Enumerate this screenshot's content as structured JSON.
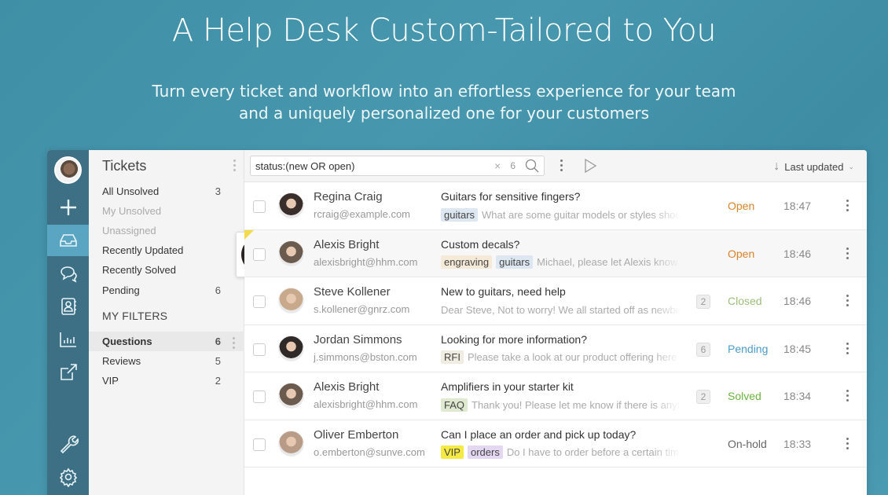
{
  "hero": {
    "title": "A Help Desk Custom-Tailored to You",
    "subtitle_line1": "Turn every ticket and workflow into an effortless experience for your team",
    "subtitle_line2": "and a uniquely personalized one for your customers"
  },
  "rail": {
    "items": [
      {
        "icon": "add-icon",
        "label": "New"
      },
      {
        "icon": "inbox-icon",
        "label": "Tickets",
        "active": true
      },
      {
        "icon": "chat-icon",
        "label": "Conversations"
      },
      {
        "icon": "contacts-icon",
        "label": "Contacts"
      },
      {
        "icon": "reports-icon",
        "label": "Reports"
      },
      {
        "icon": "external-link-icon",
        "label": "Open"
      },
      {
        "icon": "wrench-icon",
        "label": "Tools"
      },
      {
        "icon": "gear-icon",
        "label": "Settings"
      }
    ]
  },
  "filters": {
    "title": "Tickets",
    "views": [
      {
        "label": "All Unsolved",
        "count": "3",
        "muted": false
      },
      {
        "label": "My Unsolved",
        "count": "",
        "muted": true
      },
      {
        "label": "Unassigned",
        "count": "",
        "muted": true
      },
      {
        "label": "Recently Updated",
        "count": "",
        "muted": false
      },
      {
        "label": "Recently Solved",
        "count": "",
        "muted": false
      },
      {
        "label": "Pending",
        "count": "6",
        "muted": false
      }
    ],
    "my_filters_heading": "MY FILTERS",
    "my_filters": [
      {
        "label": "Questions",
        "count": "6",
        "selected": true
      },
      {
        "label": "Reviews",
        "count": "5"
      },
      {
        "label": "VIP",
        "count": "2"
      }
    ]
  },
  "toolbar": {
    "search_value": "status:(new OR open)",
    "result_count": "6",
    "clear_glyph": "×",
    "sort_label": "Last updated"
  },
  "tickets": [
    {
      "name": "Regina Craig",
      "email": "rcraig@example.com",
      "subject": "Guitars for sensitive fingers?",
      "tags": [
        "guitars"
      ],
      "preview": "What are some guitar models or styles should",
      "replies": "",
      "status": "Open",
      "time": "18:47",
      "highlight": false,
      "flag": false
    },
    {
      "name": "Alexis Bright",
      "email": "alexisbright@hhm.com",
      "subject": "Custom decals?",
      "tags": [
        "engraving",
        "guitars"
      ],
      "preview": "Michael, please let Alexis know",
      "replies": "",
      "status": "Open",
      "time": "18:46",
      "highlight": true,
      "flag": true
    },
    {
      "name": "Steve Kollener",
      "email": "s.kollener@gnrz.com",
      "subject": "New to guitars, need help",
      "tags": [],
      "preview": "Dear Steve, Not to worry! We all started off as newbies",
      "replies": "2",
      "status": "Closed",
      "time": "18:46",
      "highlight": false,
      "flag": false
    },
    {
      "name": "Jordan Simmons",
      "email": "j.simmons@bston.com",
      "subject": "Looking for more information?",
      "tags": [
        "RFI"
      ],
      "preview": "Please take a look at our product offering here",
      "replies": "6",
      "status": "Pending",
      "time": "18:45",
      "highlight": false,
      "flag": false
    },
    {
      "name": "Alexis Bright",
      "email": "alexisbright@hhm.com",
      "subject": "Amplifiers in your starter kit",
      "tags": [
        "FAQ"
      ],
      "preview": "Thank you! Please let me know if there is anything",
      "replies": "2",
      "status": "Solved",
      "time": "18:34",
      "highlight": false,
      "flag": false
    },
    {
      "name": "Oliver Emberton",
      "email": "o.emberton@sunve.com",
      "subject": "Can I place an order and pick up today?",
      "tags": [
        "VIP",
        "orders"
      ],
      "preview": "Do I have to order before a certain time",
      "replies": "",
      "status": "On-hold",
      "time": "18:33",
      "highlight": false,
      "flag": false
    }
  ],
  "status_colors": {
    "Open": "#d9822b",
    "Closed": "#9cbf7a",
    "Pending": "#4a9cc7",
    "Solved": "#6cb33f",
    "On-hold": "#666666"
  },
  "avatar_colors": [
    "#3a2e2a",
    "#6b5a4e",
    "#c9a98c",
    "#2f2a28",
    "#6b5a4e",
    "#b89c88"
  ]
}
